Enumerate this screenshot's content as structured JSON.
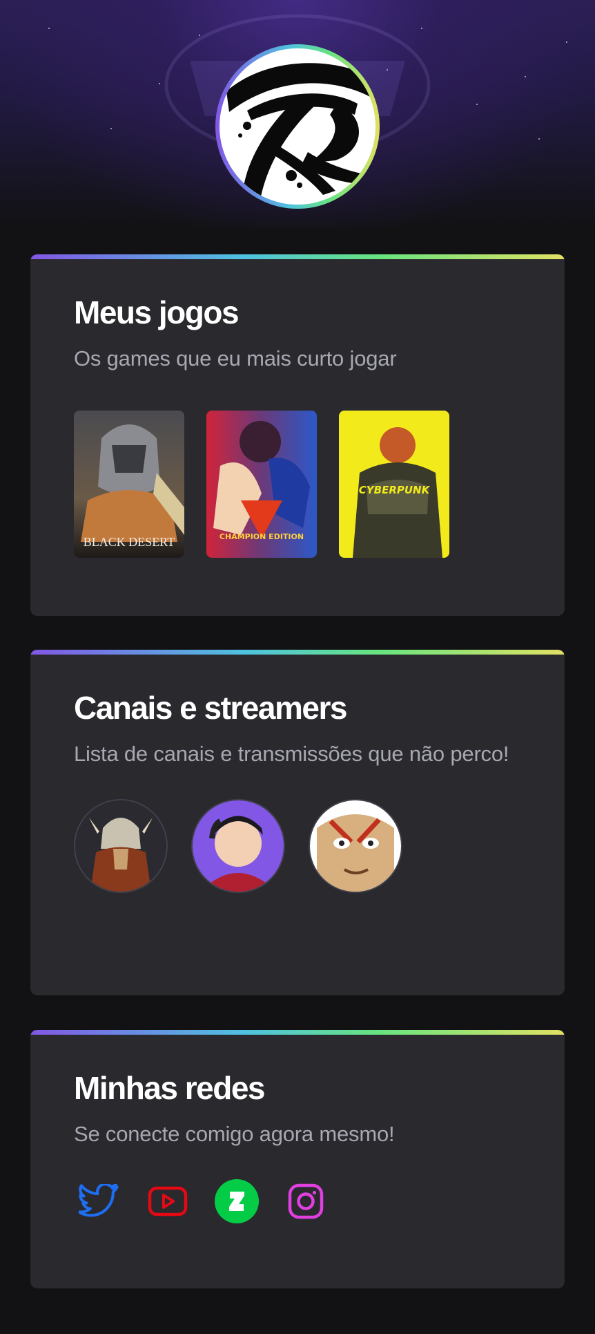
{
  "profile": {
    "avatar_icon": "r-brush-logo-icon"
  },
  "games_card": {
    "title": "Meus jogos",
    "subtitle": "Os games que eu mais curto jogar",
    "games": [
      {
        "name": "Black Desert",
        "label": "BLACK DESERT"
      },
      {
        "name": "Street Fighter V Champion Edition",
        "label": "CHAMPION EDITION"
      },
      {
        "name": "Cyberpunk 2077",
        "label": "CYBERPUNK"
      }
    ]
  },
  "channels_card": {
    "title": "Canais e streamers",
    "subtitle": "Lista de canais e transmissões que não perco!",
    "channels": [
      "viking-warrior-avatar",
      "headphones-streamer-avatar",
      "face-closeup-avatar"
    ]
  },
  "socials_card": {
    "title": "Minhas redes",
    "subtitle": "Se conecte comigo agora mesmo!",
    "links": [
      {
        "icon": "twitter-icon",
        "color": "#1d6ef0"
      },
      {
        "icon": "youtube-icon",
        "color": "#e50914"
      },
      {
        "icon": "deviantart-icon",
        "color": "#05cc47"
      },
      {
        "icon": "instagram-icon",
        "color": "#e040e0"
      }
    ]
  },
  "colors": {
    "background": "#121214",
    "card": "#29292e",
    "text": "#ffffff",
    "muted": "#a8a8b3",
    "gradient": [
      "#8257e5",
      "#4fc2e0",
      "#67e480",
      "#e1e163"
    ]
  }
}
